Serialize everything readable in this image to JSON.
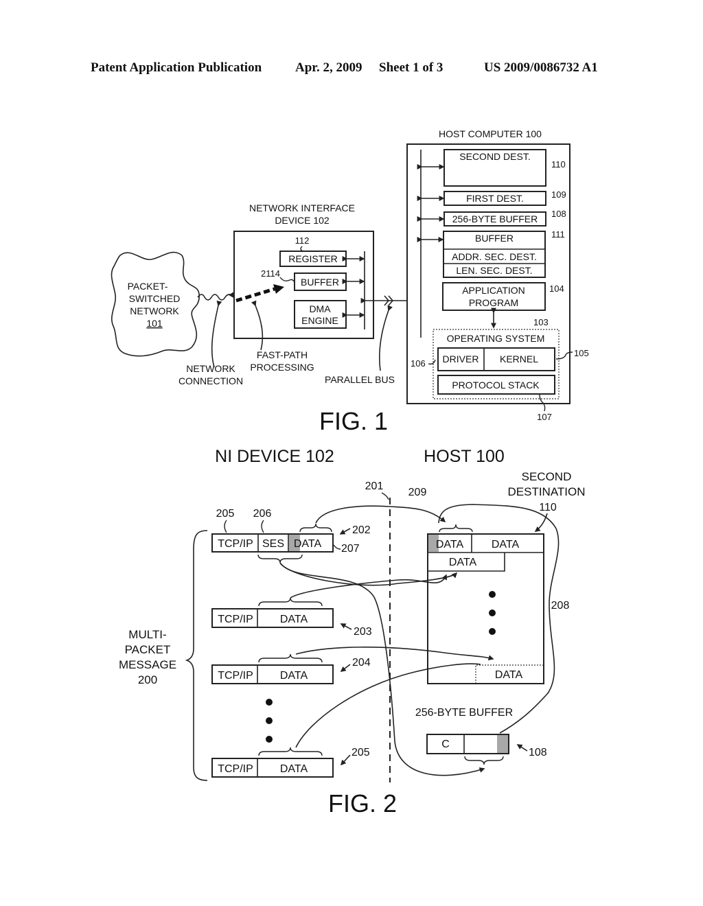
{
  "header": {
    "publication": "Patent Application Publication",
    "date": "Apr. 2, 2009",
    "sheet": "Sheet 1 of 3",
    "number": "US 2009/0086732 A1"
  },
  "fig1": {
    "caption": "FIG. 1",
    "network": {
      "line1": "PACKET-",
      "line2": "SWITCHED",
      "line3": "NETWORK",
      "ref": "101"
    },
    "nid": {
      "title1": "NETWORK INTERFACE",
      "title2": "DEVICE 102",
      "register": "REGISTER",
      "register_ref": "112",
      "buffer": "BUFFER",
      "buffer_ref": "2114",
      "dma1": "DMA",
      "dma2": "ENGINE"
    },
    "labels": {
      "network_connection1": "NETWORK",
      "network_connection2": "CONNECTION",
      "fast_path1": "FAST-PATH",
      "fast_path2": "PROCESSING",
      "parallel_bus": "PARALLEL BUS"
    },
    "host": {
      "title": "HOST COMPUTER 100",
      "second_dest": "SECOND DEST.",
      "second_dest_ref": "110",
      "first_dest": "FIRST DEST.",
      "first_dest_ref": "109",
      "byte_buffer": "256-BYTE BUFFER",
      "byte_buffer_ref": "108",
      "buffer": "BUFFER",
      "buffer_ref": "111",
      "addr_sec": "ADDR. SEC. DEST.",
      "len_sec": "LEN. SEC. DEST.",
      "app1": "APPLICATION",
      "app2": "PROGRAM",
      "app_ref": "104",
      "os": "OPERATING SYSTEM",
      "os_ref": "103",
      "driver": "DRIVER",
      "driver_ref": "106",
      "kernel": "KERNEL",
      "kernel_ref": "105",
      "stack": "PROTOCOL STACK",
      "stack_ref": "107"
    }
  },
  "fig2": {
    "caption": "FIG. 2",
    "ni_title": "NI DEVICE 102",
    "host_title": "HOST 100",
    "second_dest1": "SECOND",
    "second_dest2": "DESTINATION",
    "second_dest_ref": "110",
    "divider_ref": "201",
    "arrow_209": "209",
    "arrow_208": "208",
    "message1": "MULTI-",
    "message2": "PACKET",
    "message3": "MESSAGE",
    "message_ref": "200",
    "ref_205_top": "205",
    "ref_206": "206",
    "ref_207": "207",
    "packets": [
      {
        "ref": "202",
        "header": "TCP/IP",
        "session": "SES",
        "data": "DATA"
      },
      {
        "ref": "203",
        "header": "TCP/IP",
        "data": "DATA"
      },
      {
        "ref": "204",
        "header": "TCP/IP",
        "data": "DATA"
      },
      {
        "ref": "205",
        "header": "TCP/IP",
        "data": "DATA"
      }
    ],
    "host_buffer": {
      "cell1": "DATA",
      "cell2": "DATA",
      "cell3": "DATA",
      "cell_last": "DATA"
    },
    "byte_buffer_label": "256-BYTE BUFFER",
    "byte_buffer_cell": "C",
    "byte_buffer_ref": "108"
  }
}
